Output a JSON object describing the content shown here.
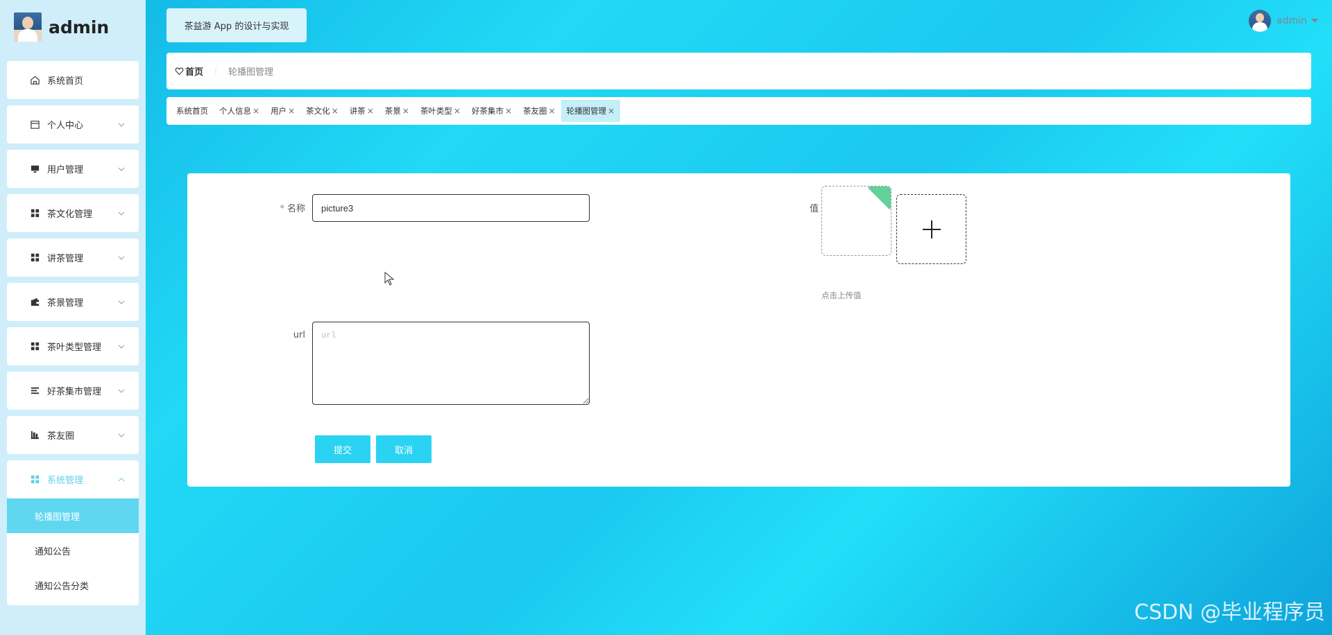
{
  "sidebar": {
    "brand_name": "admin",
    "items": [
      {
        "label": "系统首页",
        "icon": "home-icon"
      },
      {
        "label": "个人中心",
        "icon": "calendar-icon"
      },
      {
        "label": "用户管理",
        "icon": "monitor-icon"
      },
      {
        "label": "茶文化管理",
        "icon": "grid-icon"
      },
      {
        "label": "讲茶管理",
        "icon": "grid-icon"
      },
      {
        "label": "茶景管理",
        "icon": "wallet-icon"
      },
      {
        "label": "茶叶类型管理",
        "icon": "grid-icon"
      },
      {
        "label": "好茶集市管理",
        "icon": "list-icon"
      },
      {
        "label": "茶友圈",
        "icon": "chart-icon"
      },
      {
        "label": "系统管理",
        "icon": "grid-icon"
      }
    ],
    "submenu": [
      {
        "label": "轮播图管理"
      },
      {
        "label": "通知公告"
      },
      {
        "label": "通知公告分类"
      }
    ]
  },
  "header": {
    "title": "茶益游 App 的设计与实现",
    "user": "admin"
  },
  "breadcrumb": {
    "home": "首页",
    "separator": "⋮",
    "current": "轮播图管理"
  },
  "tabs": [
    {
      "label": "系统首页",
      "closable": false
    },
    {
      "label": "个人信息",
      "closable": true
    },
    {
      "label": "用户",
      "closable": true
    },
    {
      "label": "茶文化",
      "closable": true
    },
    {
      "label": "讲茶",
      "closable": true
    },
    {
      "label": "茶景",
      "closable": true
    },
    {
      "label": "茶叶类型",
      "closable": true
    },
    {
      "label": "好茶集市",
      "closable": true
    },
    {
      "label": "茶友圈",
      "closable": true
    },
    {
      "label": "轮播图管理",
      "closable": true
    }
  ],
  "tab_close_glyph": "×",
  "form": {
    "name_required": "*",
    "name_label": "名称",
    "name_value": "picture3",
    "url_label": "url",
    "url_placeholder": "url",
    "value_label": "值",
    "upload_hint": "点击上传值",
    "submit": "提交",
    "cancel": "取消"
  },
  "watermark": "CSDN @毕业程序员",
  "colors": {
    "accent": "#2bd3f2",
    "sidebar_bg": "#cfeefa",
    "active_text": "#5fd0ea"
  }
}
